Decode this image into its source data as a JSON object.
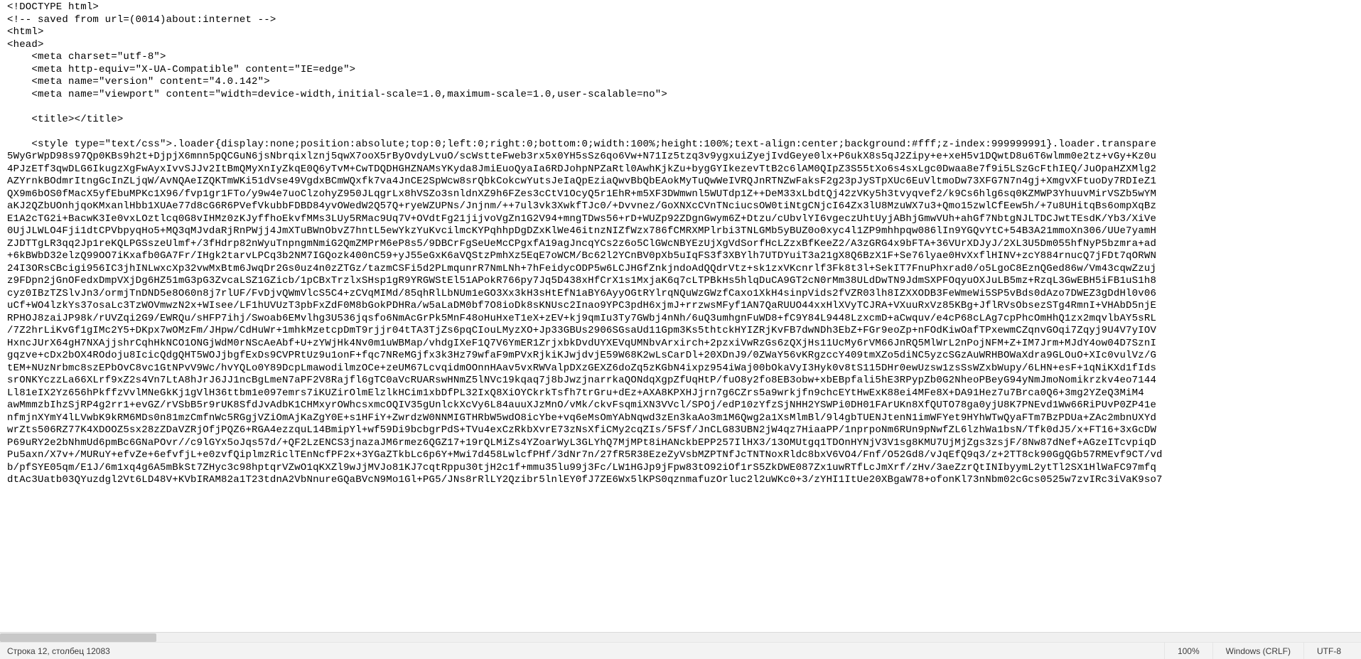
{
  "editor": {
    "lines": [
      "<!DOCTYPE html>",
      "<!-- saved from url=(0014)about:internet -->",
      "<html>",
      "<head>",
      "    <meta charset=\"utf-8\">",
      "    <meta http-equiv=\"X-UA-Compatible\" content=\"IE=edge\">",
      "    <meta name=\"version\" content=\"4.0.142\">",
      "    <meta name=\"viewport\" content=\"width=device-width,initial-scale=1.0,maximum-scale=1.0,user-scalable=no\">",
      "",
      "    <title></title>",
      "",
      "    <style type=\"text/css\">.loader{display:none;position:absolute;top:0;left:0;right:0;bottom:0;width:100%;height:100%;text-align:center;background:#fff;z-index:999999991}.loader.transpare",
      "5WyGrWpD98s97Qp0KBs9h2t+DjpjX6mnn5pQCGuN6jsNbrqixlznj5qwX7ooX5rByOvdyLvuO/scWstteFweb3rx5x0YH5sSz6qo6Vw+N71Iz5tzq3v9ygxuiZyejIvdGeye0lx+P6ukX8s5qJ2Zipy+e+xeH5v1DQwtD8u6T6wlmm0e2tz+vGy+Kz0u",
      "4PJzETf3qwDLG6IkugzXgFwAyxIvvSJJv2ItBmQMyXnIyZkqE0Q6yTvM+CwTDQDHGHZNAMsYKyda8JmiEuoQyaIa6RDJohpNPZaRtl0AwhKjkZu+bygGYIkezevTtB2c6lAM0QIpZ3S55tXo6s4sxLgc0Dwaa8e7f9i5LSzGcFthIEQ/JuOpaHZXMlg2",
      "AZYrnkBOdmrItngGcInZLjqW/AvNQAeIZQKTmWKi51dVse49VgdxBCmWQxfk7va4JnCE2SpWcw8srQbkCokcwYutsJeIaQpEziaQwvBbQbEAokMyTuQwWeIVRQJnRTNZwFaksF2g23pJySTpXUc6EuVltmoDw73XFG7N7n4gj+XmgvXFtuoDy7RDIeZ1",
      "QX9m6bOS0fMacX5yfEbuMPKc1X96/fvp1gr1FTo/y9w4e7uoClzohyZ950JLqgrLx8hVSZo3snldnXZ9h6FZes3cCtV1OcyQ5r1EhR+m5XF3DWmwnl5WUTdp1Z++DeM33xLbdtQj42zVKy5h3tvyqvef2/k9Cs6hlg6sq0KZMWP3YhuuvMirVSZb5wYM",
      "aKJ2QZbUOnhjqoKMxanlHbb1XUAe77d8cG6R6PVefVkubbFDBD84yvOWedW2Q57Q+ryeWZUPNs/Jnjnm/++7ul3vk3XwkfTJc0/+Dvvnez/GoXNXcCVnTNciucsOW0tiNtgCNjcI64Zx3lU8MzuWX7u3+Qmo15zwlCfEew5h/+7u8UHitqBs6ompXqBz",
      "E1A2cTG2i+BacwK3Ie0vxLOztlcq0G8vIHMz0zKJyffhoEkvfMMs3LUy5RMac9Uq7V+OVdtFg21jijvoVgZn1G2V94+mngTDws56+rD+WUZp92ZDgnGwym6Z+Dtzu/cUbvlYI6vgeczUhtUyjABhjGmwVUh+ahGf7NbtgNJLTDCJwtTEsdK/Yb3/XiVe",
      "0UjJLWLO4Fji1dtCPVbpyqHo5+MQ3qMJvdaRjRnPWjj4JmXTuBWnObvZ7hntL5ewYkzYuKvcilmcKYPqhhpDgDZxKlWe46itnzNIZfWzx786fCMRXMPlrbi3TNLGMb5yBUZ0o0xyc4l1ZP9mhhpqw086lIn9YGQvYtC+54B3A21mmoXn306/UUe7yamH",
      "ZJDTTgLR3qq2Jp1reKQLPGSszeUlmf+/3fHdrp82nWyuTnpngmNmiG2QmZMPrM6eP8s5/9DBCrFgSeUeMcCPgxfA19agJncqYCs2z6o5ClGWcNBYEzUjXgVdSorfHcLZzxBfKeeZ2/A3zGRG4x9bFTA+36VUrXDJyJ/2XL3U5Dm055hfNyP5bzmra+ad",
      "+6kBWbD32elzQ99OO7iKxafb0GA7Fr/IHgk2tarvLPCq3b2NM7IGQozk400nC59+yJ55eGxK6aVQStzPmhXz5EqE7oWCM/Bc62l2YCnBV0pXb5uIqFS3f3XBYlh7UTDYuiT3a21gX8Q6BzX1F+Se76lyae0HvXxflHINV+zcY884rnucQ7jFDt7qORWN",
      "24I3ORsCBcigi956IC3jhINLwxcXp32vwMxBtm6JwqDr2Gs0uz4n0zZTGz/tazmCSFi5d2PLmqunrR7NmLNh+7hFeidycODP5w6LCJHGfZnkjndoAdQQdrVtz+sk1zxVKcnrlf3Fk8t3l+SekIT7FnuPhxrad0/o5LgoC8EznQGed86w/Vm43cqwZzuj",
      "z9FDpn2jGnOFedxDmpVXjDg6HZ51mG3pG3ZvcaLSZ1GZicb/1pCBxTrzlxSHsp1gR9YRGWStEl51APokR766py7Jq5D438xHfCrX1s1MxjaK6q7cLTPBkHs5hlqDuCA9GT2cN0rMm38ULdDwTN9JdmSXPFOqyuOXJuLB5mz+RzqL3GwEBH5iFB1uS1h8",
      "cyz0IBzTZSlvJn3/ormjTnDND5e8O60n8j7rlUF/FvDjvQWmVlcS5C4+zCVqMIMd/85qhRlLbNUm1eGO3Xx3kH3sHtEfN1aBY6AyyOGtRYlrqNQuWzGWzfCaxo1XkH4sinpVids2fVZR03lh8IZXXODB3FeWmeWi5SP5vBds0dAzo7DWEZ3gDdHl0v06",
      "uCf+WO4lzkYs37osaLc3TzWOVmwzN2x+WIsee/LF1hUVUzT3pbFxZdF0M8bGokPDHRa/w5aLaDM0bf7O8ioDk8sKNUsc2Inao9YPC3pdH6xjmJ+rrzwsMFyf1AN7QaRUUO44xxHlXVyTCJRA+VXuuRxVz85KBg+JflRVsObsezSTg4RmnI+VHAbD5njE",
      "RPHOJ8zaiJP98k/rUVZqi2G9/EWRQu/sHFP7ihj/Swoab6EMvlhg3U536jqsfo6NmAcGrPk5MnF48oHuHxeT1eX+zEV+kj9qmIu3Ty7GWbj4nNh/6uQ3umhgnFuWD8+fC9Y84L9448LzxcmD+aCwquv/e4cP68cLAg7cpPhcOmHhQ1zx2mqvlbAY5sRL",
      "/7Z2hrLiKvGf1gIMc2Y5+DKpx7wOMzFm/JHpw/CdHuWr+1mhkMzetcpDmT9rjjr04tTA3TjZs6pqCIouLMyzXO+Jp33GBUs2906SGsaUd11Gpm3Ks5thtckHYIZRjKvFB7dwNDh3EbZ+FGr9eoZp+nFOdKiwOafTPxewmCZqnvGOqi7Zqyj9U4V7yIOV",
      "HxncJUrX64gH7NXAjjshrCqhHkNCO1ONGjWdM0rNScAeAbf+U+zYWjHk4Nv0m1uWBMap/vhdgIXeF1Q7V6YmER1ZrjxbkDvdUYXEVqUMNbvArxirch+2pzxiVwRzGs6zQXjHs11UcMy6rVM66JnRQ5MlWrL2nPojNFM+Z+IM7Jrm+MJdY4ow04D7SznI",
      "gqzve+cDx2bOX4ROdoju8IcicQdgQHT5WOJjbgfExDs9CVPRtUz9u1onF+fqc7NReMGjfx3k3Hz79wfaF9mPVxRjkiKJwjdvjE59W68K2wLsCarDl+20XDnJ9/0ZWaY56vKRgzccY409tmXZo5diNC5yzcSGzAuWRHBOWaXdra9GLOuO+XIc0vulVz/G",
      "tEM+NUzNrbmc8szEPbOvC8vc1GtNPvV9Wc/hvYQLo0Y89DcpLmawodilmzOCe+zeUM67LcvqidmOOnnHAav5vxRWValpDXzGEXZ6doZq5zKGbN4ixpz954iWaj00bOkaVyI3Hyk0v8tS115DHr0ewUzsw1zsSsWZxbWupy/6LHN+esF+1qNiKXd1fIds",
      "srONKYczzLa66XLrf9xZ2s4Vn7LtA8hJrJ6JJ1ncBgLmeN7aPF2V8Rajfl6gTC0aVcRUARswHNmZ5lNVc19kqaq7j8bJwzjnarrkaQONdqXgpZfUqHtP/fuO8y2fo8EB3obw+xbEBpfali5hE3RPypZb0G2NheoPBeyG94yNmJmoNomikrzkv4eo7144",
      "Ll81eIX2Yz656hPkffzVvlMNeGkKj1gVlH36ttbm1e097emrs7iKUZirOlmElzlkHCim1xbDfPL32IxQ8XiOYCkrkTsfh7trGru+dEz+AXA8KPXHJjrn7g6CZrs5a9wrkjfn9chcEYtHwExK88ei4MFe8X+DA91Hez7u7Brca0Q6+3mg2YZeQ3MiM4",
      "awMmmzbIhzSjRP4g2rr1+evGZ/rVSbB5r9rUK8SfdJvAdbK1CHMxyrOWhcsxmcOQIV35gUnlckXcVy6L84auuXJzMnO/vMk/ckvFsqmiXN3VVcl/SPOj/edP10zYfzSjNHH2YSWPi0DH01FArUKn8XfQUTO78ga0yjU8K7PNEvd1Ww66RiPUvP0ZP41e",
      "nfmjnXYmY4lLVwbK9kRM6MDs0n81mzCmfnWc5RGgjVZiOmAjKaZgY0E+s1HFiY+ZwrdzW0NNMIGTHRbW5wdO8icYbe+vq6eMsOmYAbNqwd3zEn3kaAo3m1M6Qwg2a1XsMlmBl/9l4gbTUENJtenN1imWFYet9HYhWTwQyaFTm7BzPDUa+ZAc2mbnUXYd",
      "wrZts506RZ77K4XDOOZ5sx28zZDaVZRjOfjPQZ6+RGA4ezzquL14BmipYl+wf59Di9bcbgrPdS+TVu4exCzRkbXvrE73zNsXfiCMy2cqZIs/5FSf/JnCLG83UBN2jW4qz7HiaaPP/1nprpoNm6RUn9pNwfZL6lzhWa1bsN/Tfk0dJ5/x+FT16+3xGcDW",
      "P69uRY2e2bNhmUd6pmBc6GNaPOvr//c9lGYx5oJqs57d/+QF2LzENCS3jnazaJM6rmez6QGZ17+19rQLMiZs4YZoarWyL3GLYhQ7MjMPt8iHANckbEPP257IlHX3/13OMUtgq1TDOnHYNjV3V1sg8KMU7UjMjZgs3zsjF/8Nw87dNef+AGzeITcvpiqD",
      "Pu5axn/X7v+/MURuY+efvZe+6efvfjL+e0zvfQiplmzRiclTEnNcfPF2x+3YGaZTkbLc6p6Y+Mwi7d458LwlcfPHf/3dNr7n/27fR5R38EzeZyVsbMZPTNfJcTNTNoxRldc8bxV6VO4/Fnf/O52Gd8/vJqEfQ9q3/z+2TT8ck90GgQGb57RMEvf9CT/vd",
      "b/pfSYE05qm/E1J/6m1xq4g6A5mBkSt7ZHyc3c98hptqrVZwO1qKXZl9wJjMVJo81KJ7cqtRppu30tjH2c1f+mmu35lu99j3Fc/LW1HGJp9jFpw83tO92iOf1rS5ZkDWE087Zx1uwRTfLcJmXrf/zHv/3aeZzrQtINIbyymL2ytTl2SX1HlWaFC97mfq",
      "dtAc3Uatb03QYuzdgl2Vt6LD48V+KVbIRAM82a1T23tdnA2VbNnureGQaBVcN9Mo1Gl+PG5/JNs8rRlLY2Qzibr5lnlEY0fJ7ZE6Wx5lKPS0qznmafuzOrluc2l2uWKc0+3/zYHI1ItUe20XBgaW78+ofonKl73nNbm02cGcs0525w7zvIRc3iVaK9so7"
    ]
  },
  "statusbar": {
    "position": "Строка 12, столбец 12083",
    "zoom": "100%",
    "eol": "Windows (CRLF)",
    "encoding": "UTF-8"
  }
}
